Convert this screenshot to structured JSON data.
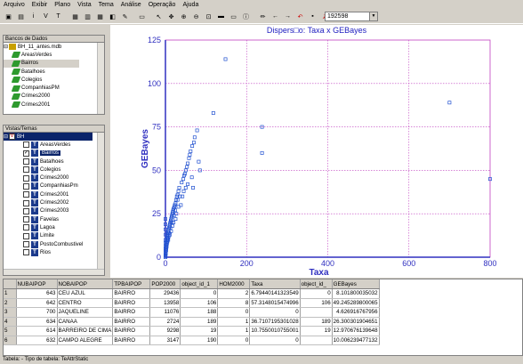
{
  "menu": [
    "Arquivo",
    "Exibir",
    "Plano",
    "Vista",
    "Tema",
    "Análise",
    "Operação",
    "Ajuda"
  ],
  "toolbar": {
    "icons": [
      "open-db-icon",
      "save-icon",
      "info-icon",
      "view-icon",
      "theme-icon",
      "sep",
      "layers-icon",
      "plan-icon",
      "table-icon",
      "graph-icon",
      "draw-icon",
      "sep",
      "window-icon",
      "sep",
      "pointer-icon",
      "pan-icon",
      "zoom-in-icon",
      "zoom-out-icon",
      "zoom-area-icon",
      "fit-icon",
      "measure-icon",
      "info-point-icon",
      "sep",
      "pencil-icon",
      "arrow-left-icon",
      "arrow-right-icon",
      "undo-icon",
      "select-icon",
      "delete-icon"
    ],
    "scale_value": "192598"
  },
  "databases_panel": {
    "title": "Bancos de Dados",
    "root": "BH_11_antes.mdb",
    "items": [
      "AreasVerdes",
      "Bairros",
      "Batalhoes",
      "Colegios",
      "CompanhiasPM",
      "Crimes2000",
      "Crimes2001"
    ]
  },
  "views_panel": {
    "title": "Vistas/Temas",
    "root": "BH",
    "items": [
      {
        "label": "AreasVerdes",
        "checked": false
      },
      {
        "label": "Bairros",
        "checked": true
      },
      {
        "label": "Batalhoes",
        "checked": false
      },
      {
        "label": "Colegios",
        "checked": false
      },
      {
        "label": "Crimes2000",
        "checked": false
      },
      {
        "label": "CompanhiasPm",
        "checked": false
      },
      {
        "label": "Crimes2001",
        "checked": false
      },
      {
        "label": "Crimes2002",
        "checked": false
      },
      {
        "label": "Crimes2003",
        "checked": false
      },
      {
        "label": "Favelas",
        "checked": false
      },
      {
        "label": "Lagoa",
        "checked": false
      },
      {
        "label": "Limite",
        "checked": false
      },
      {
        "label": "PostoCombustivel",
        "checked": false
      },
      {
        "label": "Rios",
        "checked": false
      }
    ]
  },
  "chart_data": {
    "type": "scatter",
    "title": "Dispers□o: Taxa x GEBayes",
    "xlabel": "Taxa",
    "ylabel": "GEBayes",
    "xlim": [
      0,
      800
    ],
    "ylim": [
      0,
      125
    ],
    "xticks": [
      "0",
      "200",
      "400",
      "600",
      "800"
    ],
    "yticks": [
      "0",
      "25",
      "50",
      "75",
      "100",
      "125"
    ],
    "grid": true,
    "colors": {
      "points": "#2050d0",
      "grid": "#c040c0",
      "axis": "#3030c0"
    },
    "points": [
      [
        148,
        114
      ],
      [
        700,
        89
      ],
      [
        118,
        83
      ],
      [
        238,
        75
      ],
      [
        78,
        73
      ],
      [
        72,
        69
      ],
      [
        70,
        66
      ],
      [
        66,
        64
      ],
      [
        62,
        61
      ],
      [
        60,
        59
      ],
      [
        58,
        57
      ],
      [
        55,
        54
      ],
      [
        53,
        52
      ],
      [
        50,
        50
      ],
      [
        48,
        48
      ],
      [
        46,
        47
      ],
      [
        44,
        45
      ],
      [
        40,
        43
      ],
      [
        238,
        60
      ],
      [
        800,
        45
      ],
      [
        34,
        40
      ],
      [
        32,
        38
      ],
      [
        30,
        36
      ],
      [
        28,
        35
      ],
      [
        26,
        33
      ],
      [
        25,
        31
      ],
      [
        23,
        30
      ],
      [
        22,
        29
      ],
      [
        20,
        28
      ],
      [
        19,
        27
      ],
      [
        18,
        26
      ],
      [
        17,
        25
      ],
      [
        16,
        24
      ],
      [
        15,
        23
      ],
      [
        14,
        22
      ],
      [
        13,
        21
      ],
      [
        12,
        20
      ],
      [
        11,
        19
      ],
      [
        10,
        18
      ],
      [
        9,
        17
      ],
      [
        8,
        16
      ],
      [
        7,
        15
      ],
      [
        6,
        14
      ],
      [
        5,
        13
      ],
      [
        5,
        12
      ],
      [
        4,
        11
      ],
      [
        4,
        10
      ],
      [
        3,
        9
      ],
      [
        3,
        8
      ],
      [
        2,
        7
      ],
      [
        2,
        6
      ],
      [
        2,
        5
      ],
      [
        1,
        4
      ],
      [
        1,
        3
      ],
      [
        1,
        2
      ],
      [
        0.5,
        1
      ],
      [
        0.3,
        0.5
      ],
      [
        0,
        0
      ],
      [
        45,
        38
      ],
      [
        36,
        35
      ],
      [
        30,
        33
      ],
      [
        24,
        27
      ],
      [
        21,
        24
      ],
      [
        16,
        20
      ],
      [
        12,
        17
      ],
      [
        9,
        14
      ],
      [
        6,
        11
      ],
      [
        4,
        8
      ],
      [
        3,
        6
      ],
      [
        2,
        4
      ],
      [
        65,
        46
      ],
      [
        68,
        40
      ],
      [
        85,
        50
      ],
      [
        82,
        55
      ],
      [
        55,
        42
      ],
      [
        50,
        40
      ],
      [
        42,
        35
      ],
      [
        38,
        30
      ],
      [
        32,
        29
      ],
      [
        27,
        25
      ],
      [
        25,
        22
      ],
      [
        20,
        20
      ],
      [
        17,
        18
      ],
      [
        14,
        15
      ],
      [
        11,
        13
      ],
      [
        8,
        12
      ],
      [
        7,
        10
      ],
      [
        5,
        9
      ],
      [
        3,
        7
      ],
      [
        1,
        5
      ],
      [
        0,
        22
      ],
      [
        0,
        19
      ],
      [
        0,
        16
      ],
      [
        0,
        13
      ],
      [
        0,
        10
      ],
      [
        0,
        8
      ],
      [
        0,
        6
      ],
      [
        0,
        4
      ],
      [
        0,
        2
      ],
      [
        0,
        1
      ]
    ]
  },
  "table": {
    "headers": [
      "",
      "NUBAIPOP",
      "NOBAIPOP",
      "TPBAIPOP",
      "POP2000",
      "object_id_1",
      "HOM2000",
      "Taxa",
      "object_id_",
      "GEBayes"
    ],
    "rows": [
      [
        "1",
        "643",
        "CEU AZUL",
        "BAIRRO",
        "29436",
        "0",
        "2",
        "6.79440141323549",
        "0",
        "8.101800035032"
      ],
      [
        "2",
        "642",
        "CENTRO",
        "BAIRRO",
        "13958",
        "106",
        "8",
        "57.3148015474996",
        "106",
        "49.245289800065"
      ],
      [
        "3",
        "700",
        "JAQUELINE",
        "BAIRRO",
        "11076",
        "188",
        "0",
        "0",
        "",
        "4.626916767956"
      ],
      [
        "4",
        "634",
        "CANAA",
        "BAIRRO",
        "2724",
        "189",
        "1",
        "36.7107195301028",
        "189",
        "26.300301904651"
      ],
      [
        "5",
        "614",
        "BARREIRO DE CIMA",
        "BAIRRO",
        "9298",
        "19",
        "1",
        "10.7550010755001",
        "19",
        "12.970676139648"
      ],
      [
        "6",
        "632",
        "CAMPO ALEGRE",
        "BAIRRO",
        "3147",
        "190",
        "0",
        "0",
        "",
        "10.006239477132"
      ]
    ]
  },
  "status": "Tabela:  - Tipo de tabela: TeAttrStatic"
}
